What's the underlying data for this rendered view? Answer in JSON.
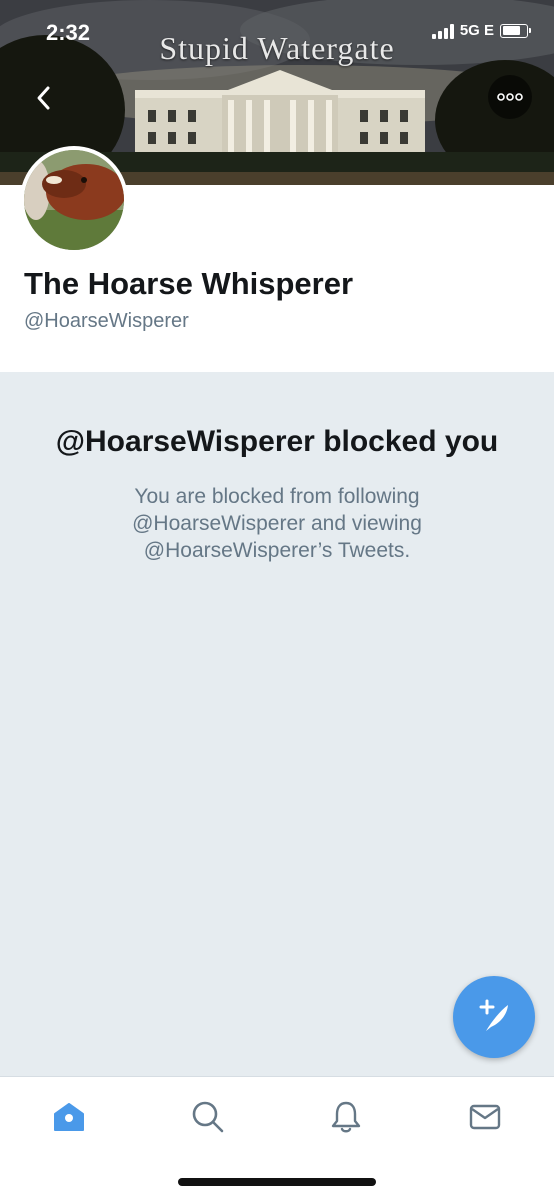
{
  "status_bar": {
    "time": "2:32",
    "network": "5G E"
  },
  "banner": {
    "title": "Stupid Watergate"
  },
  "profile": {
    "display_name": "The Hoarse Whisperer",
    "handle": "@HoarseWisperer"
  },
  "blocked": {
    "title": "@HoarseWisperer blocked you",
    "description": "You are blocked from following @HoarseWisperer and viewing @HoarseWisperer’s Tweets."
  },
  "icons": {
    "back": "chevron-left-icon",
    "more": "more-dots-icon",
    "compose": "compose-tweet-icon",
    "home": "home-icon",
    "search": "search-icon",
    "notifications": "bell-icon",
    "messages": "mail-icon"
  },
  "colors": {
    "accent": "#4a99e9",
    "background": "#e6ecf0",
    "text_primary": "#14171a",
    "text_secondary": "#657786"
  }
}
